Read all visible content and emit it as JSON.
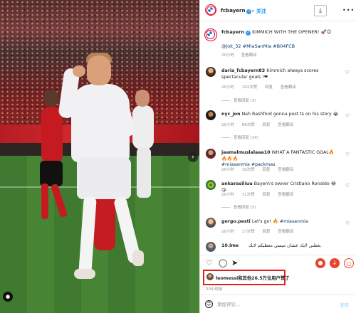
{
  "post": {
    "account": "fcbayern",
    "follow_label": "关注",
    "more_label": "•••",
    "download_icon": "download-icon"
  },
  "caption": {
    "username": "fcbayern",
    "text": "KIMMICH WITH THE OPENER! 🚀😊",
    "tags": "@jok_32 #MiaSanMia #B04FCB",
    "time": "20小时",
    "translate": "查看翻译"
  },
  "comments": [
    {
      "username": "daria_fcbayern83",
      "text": "Kimmich always scores spectacular goals !❤",
      "time": "20小时",
      "likes": "102次赞",
      "reply": "回复",
      "translate": "查看翻译",
      "replies": "查看回复 (3)"
    },
    {
      "username": "nyc_jon",
      "text": "Nah Rashford gonna post ts on his story 😭",
      "time": "20小时",
      "likes": "86次赞",
      "reply": "回复",
      "translate": "查看翻译",
      "replies": "查看回复 (14)"
    },
    {
      "username": "jaamalmuslalaaa10",
      "text": "WHAT A FANTASTIC GOAL🔥🔥🔥🔥",
      "hashtags": "#miasanmia #packmas",
      "time": "20小时",
      "likes": "10次赞",
      "reply": "回复",
      "translate": "查看翻译"
    },
    {
      "username": "ankarasiliuu",
      "text": "Bayern's owner Cristiano Ronaldo 😂😘",
      "time": "20小时",
      "likes": "31次赞",
      "reply": "回复",
      "translate": "查看翻译",
      "replies": "查看回复 (5)"
    },
    {
      "username": "gergo.pesti",
      "text": "Let's go! 🔥",
      "hashtags": "#miasanmia",
      "time": "20小时",
      "likes": "17次赞",
      "reply": "回复",
      "translate": "查看翻译"
    },
    {
      "username": "10.lme",
      "text": "بعطني لايك عشان ميسي معطيكم لايك"
    }
  ],
  "likes_summary": {
    "text": "leomessi和其他26.5万位用户赞了"
  },
  "post_date": "20小时前",
  "composer": {
    "placeholder": "添加评论...",
    "post_label": "发布"
  }
}
